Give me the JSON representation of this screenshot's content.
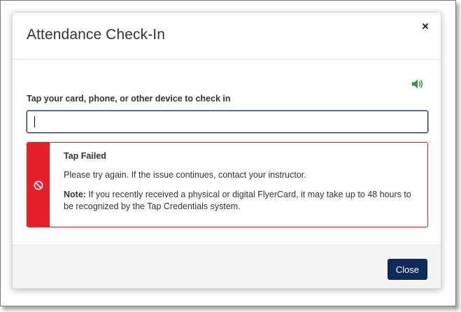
{
  "dialog": {
    "title": "Attendance Check-In",
    "close_glyph": "×"
  },
  "speaker": {
    "icon": "speaker-icon",
    "color": "#2e9b3f"
  },
  "form": {
    "label": "Tap your card, phone, or other device to check in",
    "input_value": ""
  },
  "alert": {
    "icon": "blocked-icon",
    "title": "Tap Failed",
    "message": "Please try again. If the issue continues, contact your instructor.",
    "note_label": "Note:",
    "note_text": " If you recently received a physical or digital FlyerCard, it may take up to 48 hours to be recognized by the Tap Credentials system.",
    "accent_color": "#e6202a"
  },
  "footer": {
    "close_label": "Close",
    "button_color": "#0f2b5b"
  }
}
